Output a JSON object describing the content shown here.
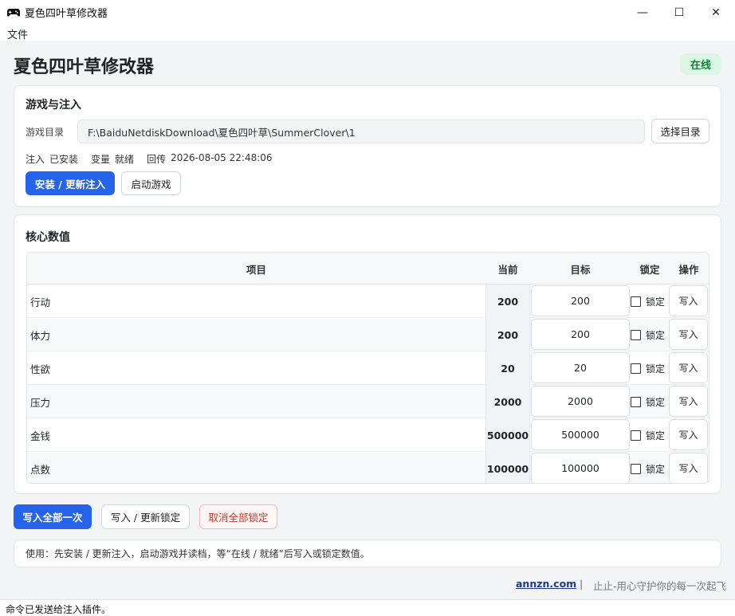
{
  "window": {
    "title": "夏色四叶草修改器",
    "minimize_glyph": "—",
    "maximize_glyph": "☐",
    "close_glyph": "✕"
  },
  "menu": {
    "file": "文件"
  },
  "header": {
    "title": "夏色四叶草修改器",
    "status_badge": "在线"
  },
  "inject_card": {
    "title": "游戏与注入",
    "dir_label": "游戏目录",
    "dir_value": "F:\\BaiduNetdiskDownload\\夏色四叶草\\SummerClover\\1",
    "choose_dir_button": "选择目录",
    "status": {
      "inject_label": "注入",
      "inject_value": "已安装",
      "var_label": "变量",
      "var_value": "就绪",
      "callback_label": "回传",
      "callback_value": "2026-08-05 22:48:06"
    },
    "install_button": "安装 / 更新注入",
    "launch_button": "启动游戏"
  },
  "values_card": {
    "title": "核心数值",
    "columns": {
      "item": "项目",
      "current": "当前",
      "target": "目标",
      "lock": "锁定",
      "action": "操作"
    },
    "lock_label": "锁定",
    "write_label": "写入",
    "rows": [
      {
        "name": "行动",
        "current": "200",
        "target": "200"
      },
      {
        "name": "体力",
        "current": "200",
        "target": "200"
      },
      {
        "name": "性欲",
        "current": "20",
        "target": "20"
      },
      {
        "name": "压力",
        "current": "2000",
        "target": "2000"
      },
      {
        "name": "金钱",
        "current": "500000",
        "target": "500000"
      },
      {
        "name": "点数",
        "current": "100000",
        "target": "100000"
      }
    ]
  },
  "actions": {
    "write_all": "写入全部一次",
    "write_update_lock": "写入 / 更新锁定",
    "cancel_all_locks": "取消全部锁定"
  },
  "tip": "使用：先安装 / 更新注入，启动游戏并读档，等“在线 / 就绪”后写入或锁定数值。",
  "footer": {
    "link": "annzn.com",
    "separator": "|",
    "slogan": "止止-用心守护你的每一次起飞"
  },
  "statusbar": "命令已发送给注入插件。",
  "colors": {
    "primary": "#2563eb",
    "online_bg": "#d9f7e3",
    "online_text": "#15803d",
    "danger": "#c0392b"
  },
  "icons": {
    "app": "gamepad-icon"
  }
}
